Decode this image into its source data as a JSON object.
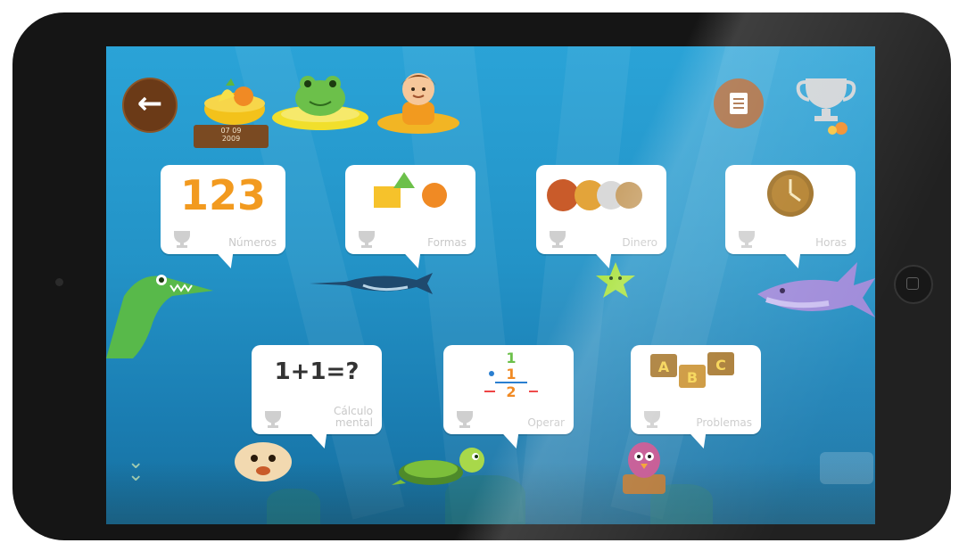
{
  "header": {
    "back_icon": "arrow-left-icon",
    "menu_icon": "document-icon",
    "trophy_icon": "trophy-icon",
    "date_line1": "07 09",
    "date_line2": "2009"
  },
  "activities": [
    {
      "id": "numbers",
      "label": "Números",
      "art_text": "123"
    },
    {
      "id": "shapes",
      "label": "Formas",
      "art_text": ""
    },
    {
      "id": "money",
      "label": "Dinero",
      "art_text": ""
    },
    {
      "id": "time",
      "label": "Horas",
      "art_text": ""
    },
    {
      "id": "mental-math",
      "label": "Cálculo mental",
      "art_text": "1+1=?"
    },
    {
      "id": "operations",
      "label": "Operar",
      "art_text": ""
    },
    {
      "id": "problems",
      "label": "Problemas",
      "art_text": "ABC"
    }
  ],
  "colors": {
    "sea": "#2393c7",
    "card": "#ffffff",
    "back_button": "#6b3a17",
    "menu_button": "#a5683c",
    "label_grey": "#c8c8c8"
  }
}
